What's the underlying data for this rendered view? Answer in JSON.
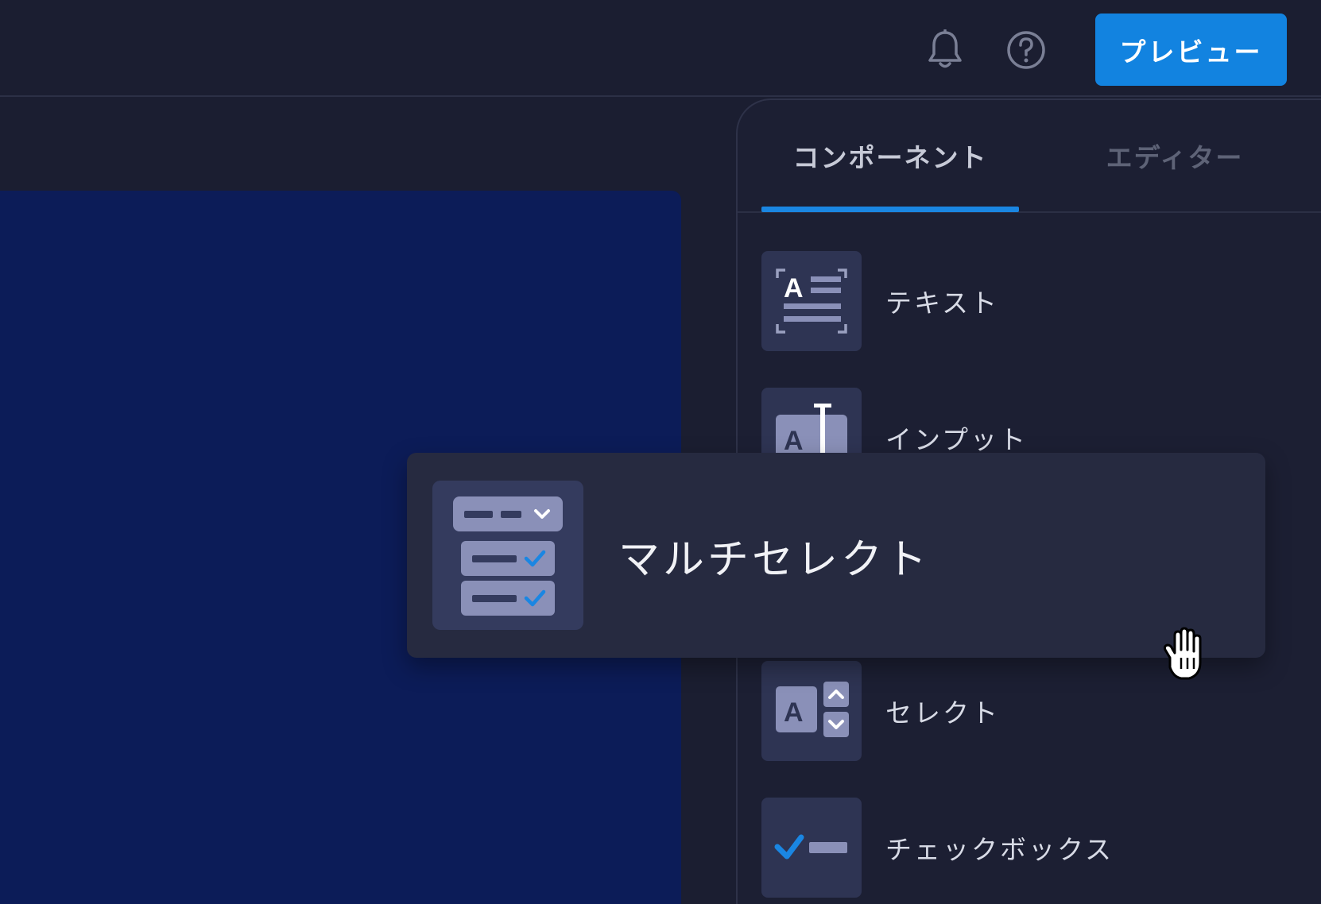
{
  "header": {
    "preview_label": "プレビュー",
    "icons": [
      "bell-icon",
      "help-icon"
    ]
  },
  "panel": {
    "tabs": [
      {
        "label": "コンポーネント",
        "active": true
      },
      {
        "label": "エディター",
        "active": false
      }
    ],
    "components": [
      {
        "label": "テキスト",
        "icon": "text-block-icon"
      },
      {
        "label": "インプット",
        "icon": "input-field-icon"
      },
      {
        "label": "セレクト",
        "icon": "select-stepper-icon"
      },
      {
        "label": "チェックボックス",
        "icon": "checkbox-icon"
      }
    ]
  },
  "drag_item": {
    "label": "マルチセレクト",
    "icon": "multiselect-icon"
  },
  "colors": {
    "accent": "#1283e0",
    "background": "#1b1e31",
    "canvas": "#0c1c58",
    "panel": "#1c1f33",
    "icon_tile": "#2e3453"
  }
}
